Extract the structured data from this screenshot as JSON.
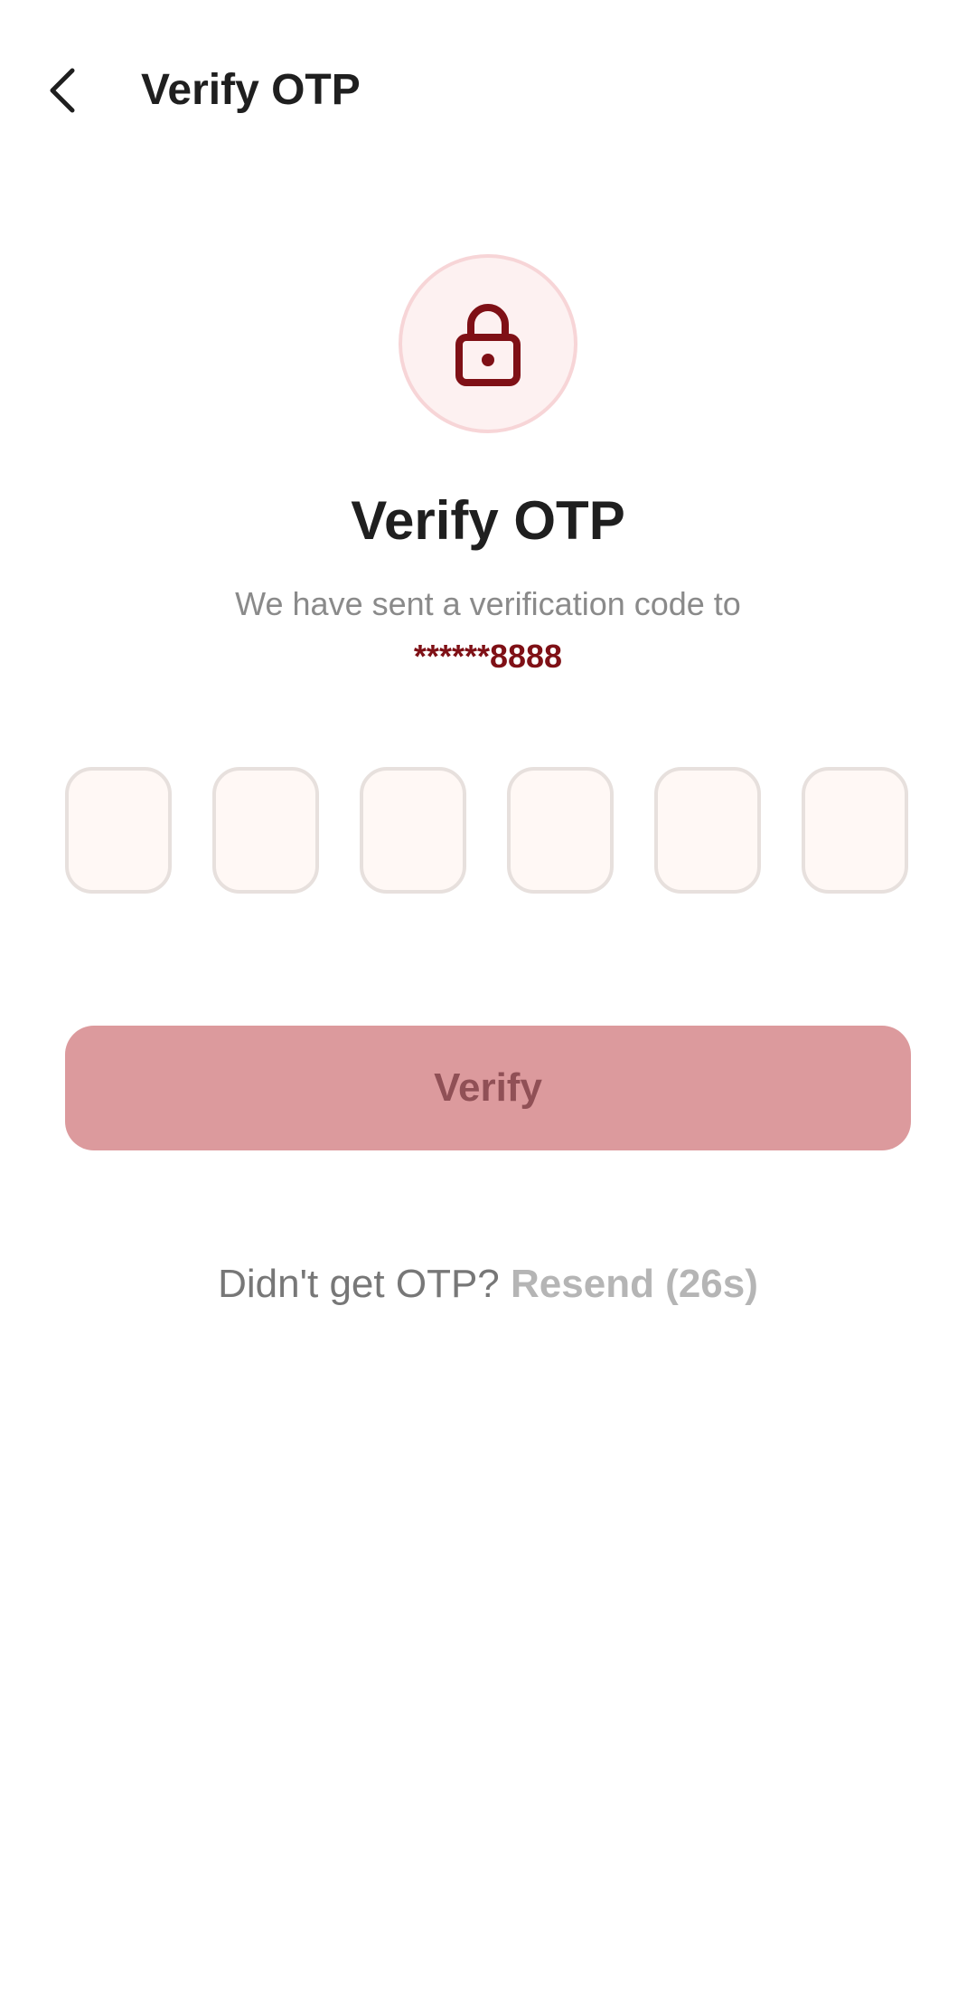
{
  "header": {
    "title": "Verify OTP"
  },
  "main": {
    "title": "Verify OTP",
    "subtitle": "We have sent a verification code to",
    "phone_masked": "******8888"
  },
  "otp": {
    "length": 6,
    "digits": [
      "",
      "",
      "",
      "",
      "",
      ""
    ]
  },
  "actions": {
    "verify_label": "Verify",
    "resend_prompt": "Didn't get OTP?",
    "resend_label": "Resend (26s)"
  },
  "icons": {
    "back": "chevron-left-icon",
    "lock": "lock-icon"
  },
  "colors": {
    "accent": "#7f1016",
    "button_disabled_bg": "#dc9a9d",
    "button_disabled_text": "#905056",
    "lock_circle_bg": "#fdf1f1",
    "otp_box_bg": "#fff8f5",
    "otp_box_border": "#e7e0dd"
  }
}
